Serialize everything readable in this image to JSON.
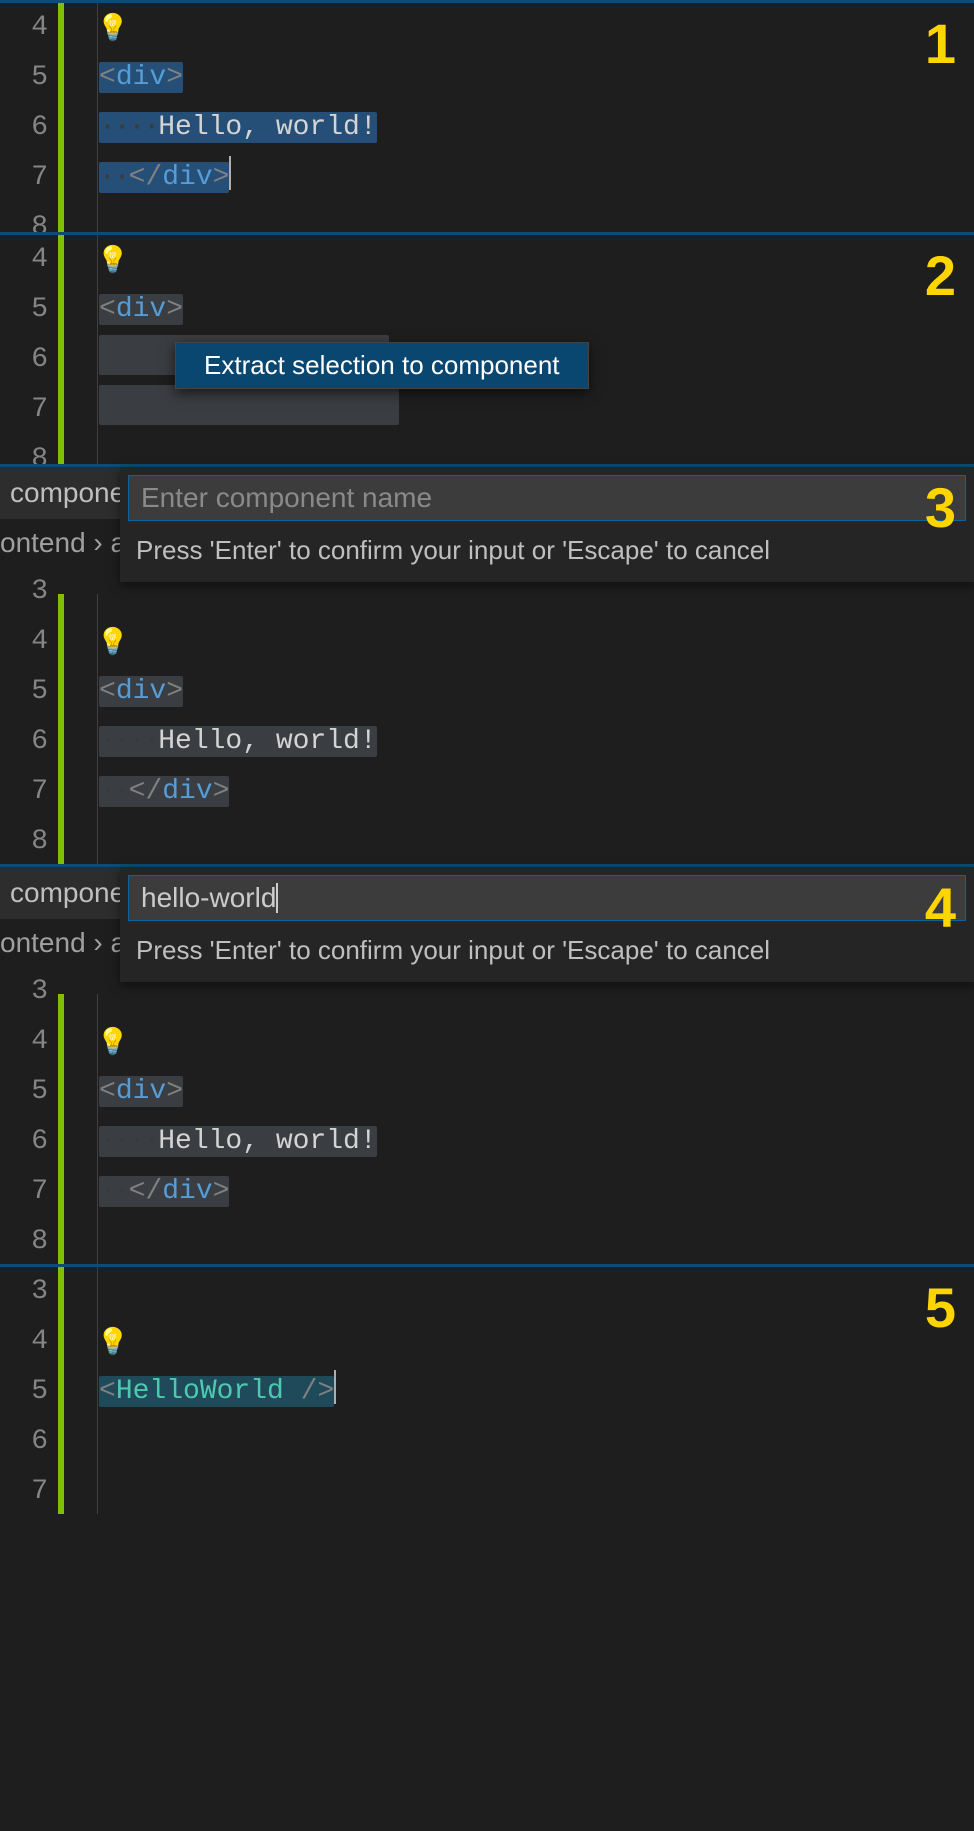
{
  "panels": [
    {
      "step": "1",
      "lines": [
        "4",
        "5",
        "6",
        "7",
        "8"
      ],
      "code": {
        "tagOpen": "div",
        "content": "Hello, world!",
        "tagClose": "div"
      },
      "selection": "blue"
    },
    {
      "step": "2",
      "lines": [
        "4",
        "5",
        "6",
        "7",
        "8"
      ],
      "code": {
        "tagOpen": "div"
      },
      "quickfix": "Extract selection to component",
      "selection": "dim"
    },
    {
      "step": "3",
      "lines": [
        "3",
        "4",
        "5",
        "6",
        "7",
        "8"
      ],
      "tab": "compone",
      "breadcrumb": "ontend  ›  a",
      "prompt": {
        "placeholder": "Enter component name",
        "value": "",
        "hint": "Press 'Enter' to confirm your input or 'Escape' to cancel"
      },
      "code": {
        "tagOpen": "div",
        "content": "Hello, world!",
        "tagClose": "div"
      },
      "selection": "dim"
    },
    {
      "step": "4",
      "lines": [
        "3",
        "4",
        "5",
        "6",
        "7",
        "8"
      ],
      "tab": "compone",
      "breadcrumb": "ontend  ›  a",
      "prompt": {
        "placeholder": "",
        "value": "hello-world",
        "hint": "Press 'Enter' to confirm your input or 'Escape' to cancel"
      },
      "code": {
        "tagOpen": "div",
        "content": "Hello, world!",
        "tagClose": "div"
      },
      "selection": "dim"
    },
    {
      "step": "5",
      "lines": [
        "3",
        "4",
        "5",
        "6",
        "7"
      ],
      "code": {
        "component": "HelloWorld"
      },
      "selection": "teal"
    }
  ]
}
